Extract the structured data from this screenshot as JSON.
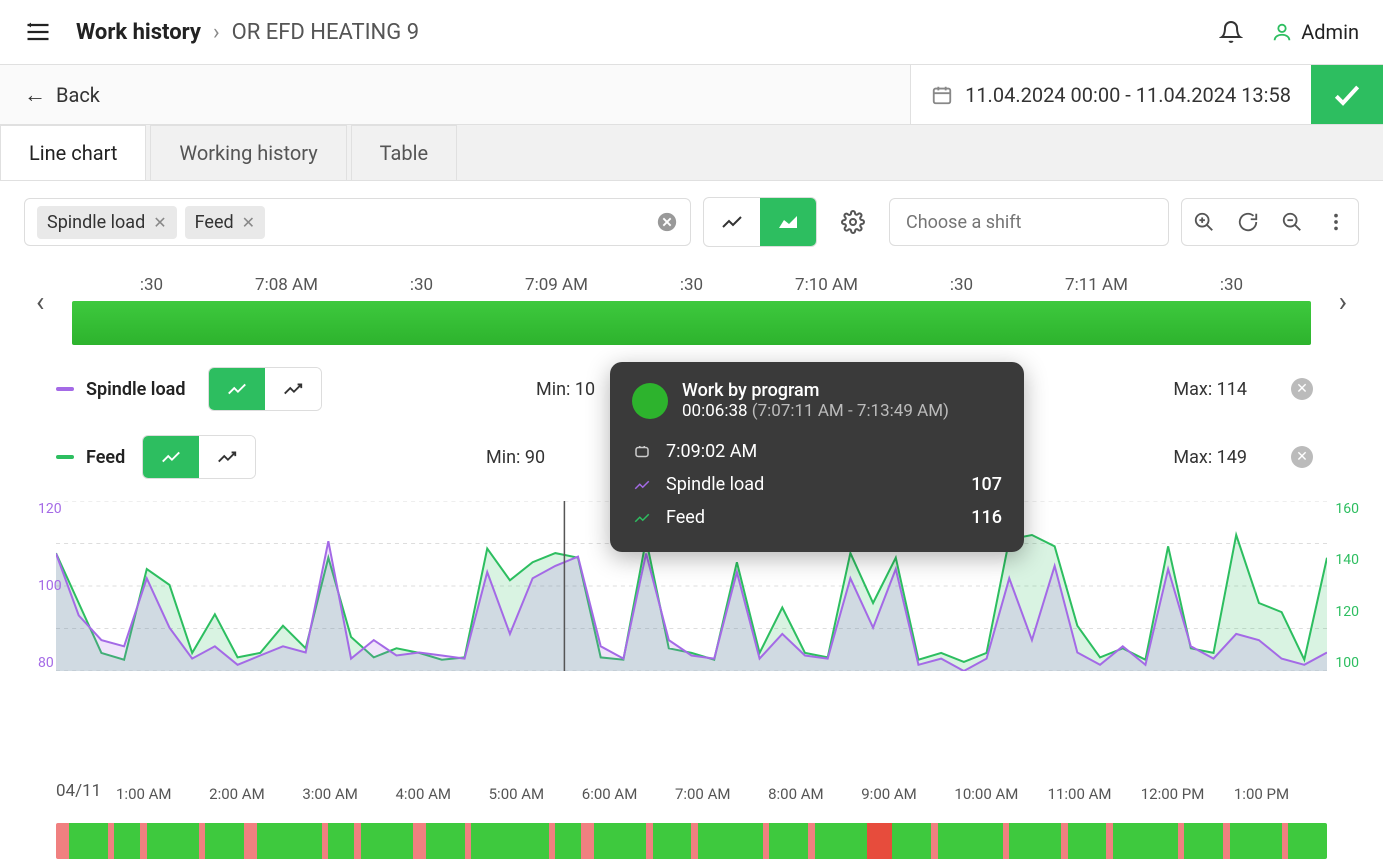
{
  "header": {
    "root": "Work history",
    "leaf": "OR EFD HEATING 9",
    "user": "Admin"
  },
  "toolbar": {
    "back": "Back",
    "date_range": "11.04.2024 00:00 - 11.04.2024 13:58"
  },
  "tabs": [
    "Line chart",
    "Working history",
    "Table"
  ],
  "active_tab": 0,
  "filter_tags": [
    "Spindle load",
    "Feed"
  ],
  "shift_placeholder": "Choose a shift",
  "timeline_ticks": [
    ":30",
    "7:08 AM",
    ":30",
    "7:09 AM",
    ":30",
    "7:10 AM",
    ":30",
    "7:11 AM",
    ":30"
  ],
  "series": [
    {
      "name": "Spindle load",
      "color": "purple",
      "min_label": "Min: 10",
      "max_label": "Max: 114"
    },
    {
      "name": "Feed",
      "color": "green",
      "min_label": "Min: 90",
      "max_label": "Max: 149"
    }
  ],
  "tooltip": {
    "title": "Work by program",
    "duration": "00:06:38",
    "range": "(7:07:11 AM - 7:13:49 AM)",
    "time": "7:09:02 AM",
    "rows": [
      {
        "label": "Spindle load",
        "value": "107",
        "color": "#a46ae6"
      },
      {
        "label": "Feed",
        "value": "116",
        "color": "#2DBE60"
      }
    ]
  },
  "overview": {
    "date": "04/11",
    "ticks": [
      "1:00 AM",
      "2:00 AM",
      "3:00 AM",
      "4:00 AM",
      "5:00 AM",
      "6:00 AM",
      "7:00 AM",
      "8:00 AM",
      "9:00 AM",
      "10:00 AM",
      "11:00 AM",
      "12:00 PM",
      "1:00 PM"
    ]
  },
  "chart_data": {
    "type": "line",
    "title": "",
    "xlabel": "time",
    "left_axis": {
      "label": "Spindle load",
      "ticks": [
        80,
        100,
        120
      ],
      "range": [
        70,
        125
      ],
      "color": "#a46ae6"
    },
    "right_axis": {
      "label": "Feed",
      "ticks": [
        100,
        120,
        140,
        160
      ],
      "range": [
        90,
        165
      ],
      "color": "#2DBE60"
    },
    "x_range_labels": [
      "7:07:30",
      "7:08:00",
      "7:08:30",
      "7:09:00",
      "7:09:30",
      "7:10:00",
      "7:10:30",
      "7:11:00",
      "7:11:30"
    ],
    "series": [
      {
        "name": "Spindle load",
        "axis": "left",
        "values": [
          108,
          88,
          80,
          78,
          100,
          84,
          74,
          78,
          72,
          75,
          78,
          76,
          112,
          74,
          80,
          75,
          76,
          75,
          74,
          102,
          82,
          100,
          104,
          107,
          78,
          74,
          108,
          80,
          75,
          74,
          102,
          74,
          82,
          75,
          74,
          100,
          84,
          103,
          72,
          74,
          70,
          74,
          100,
          80,
          104,
          76,
          72,
          78,
          72,
          103,
          78,
          74,
          82,
          80,
          74,
          72,
          76
        ]
      },
      {
        "name": "Feed",
        "axis": "right",
        "values": [
          142,
          120,
          98,
          95,
          135,
          128,
          98,
          115,
          96,
          98,
          110,
          100,
          140,
          105,
          96,
          100,
          98,
          95,
          96,
          144,
          130,
          138,
          142,
          140,
          96,
          95,
          148,
          100,
          98,
          95,
          138,
          98,
          118,
          98,
          96,
          142,
          120,
          140,
          95,
          98,
          94,
          98,
          148,
          150,
          145,
          110,
          96,
          100,
          95,
          145,
          100,
          98,
          150,
          120,
          116,
          95,
          140
        ]
      }
    ]
  },
  "overview_segments": [
    {
      "c": "r",
      "w": 1
    },
    {
      "c": "g",
      "w": 3
    },
    {
      "c": "r",
      "w": 0.5
    },
    {
      "c": "g",
      "w": 2
    },
    {
      "c": "r",
      "w": 0.5
    },
    {
      "c": "g",
      "w": 4
    },
    {
      "c": "r",
      "w": 0.5
    },
    {
      "c": "g",
      "w": 3
    },
    {
      "c": "r",
      "w": 1
    },
    {
      "c": "g",
      "w": 5
    },
    {
      "c": "r",
      "w": 0.5
    },
    {
      "c": "g",
      "w": 2
    },
    {
      "c": "r",
      "w": 0.5
    },
    {
      "c": "g",
      "w": 4
    },
    {
      "c": "r",
      "w": 1
    },
    {
      "c": "g",
      "w": 3
    },
    {
      "c": "r",
      "w": 0.5
    },
    {
      "c": "g",
      "w": 6
    },
    {
      "c": "r",
      "w": 0.5
    },
    {
      "c": "g",
      "w": 2
    },
    {
      "c": "r",
      "w": 1
    },
    {
      "c": "g",
      "w": 4
    },
    {
      "c": "r",
      "w": 0.5
    },
    {
      "c": "g",
      "w": 3
    },
    {
      "c": "r",
      "w": 0.5
    },
    {
      "c": "g",
      "w": 5
    },
    {
      "c": "r",
      "w": 0.5
    },
    {
      "c": "g",
      "w": 3
    },
    {
      "c": "r",
      "w": 0.5
    },
    {
      "c": "g",
      "w": 4
    },
    {
      "c": "dr",
      "w": 2
    },
    {
      "c": "g",
      "w": 3
    },
    {
      "c": "r",
      "w": 0.5
    },
    {
      "c": "g",
      "w": 5
    },
    {
      "c": "r",
      "w": 0.5
    },
    {
      "c": "g",
      "w": 4
    },
    {
      "c": "r",
      "w": 0.5
    },
    {
      "c": "g",
      "w": 3
    },
    {
      "c": "r",
      "w": 0.5
    },
    {
      "c": "g",
      "w": 5
    },
    {
      "c": "r",
      "w": 0.5
    },
    {
      "c": "g",
      "w": 3
    },
    {
      "c": "r",
      "w": 0.5
    },
    {
      "c": "g",
      "w": 4
    },
    {
      "c": "r",
      "w": 0.5
    },
    {
      "c": "g",
      "w": 3
    }
  ]
}
